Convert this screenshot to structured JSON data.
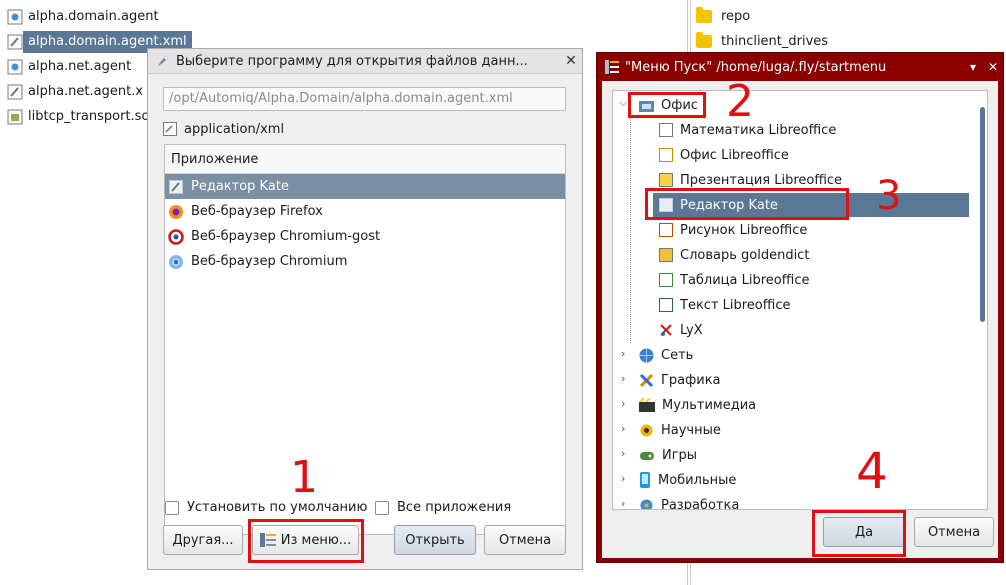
{
  "file_list": [
    {
      "name": "alpha.domain.agent",
      "icon": "gear-file-icon",
      "selected": false
    },
    {
      "name": "alpha.domain.agent.xml",
      "icon": "text-file-icon",
      "selected": true
    },
    {
      "name": "alpha.net.agent",
      "icon": "gear-file-icon",
      "selected": false
    },
    {
      "name": "alpha.net.agent.x",
      "icon": "text-file-icon",
      "selected": false
    },
    {
      "name": "libtcp_transport.so",
      "icon": "library-file-icon",
      "selected": false
    }
  ],
  "right_pane": [
    {
      "name": "repo",
      "icon": "folder-icon"
    },
    {
      "name": "thinclient_drives",
      "icon": "folder-icon"
    }
  ],
  "open_with_dialog": {
    "title": "Выберите программу для открытия файлов данн...",
    "path": "/opt/Automiq/Alpha.Domain/alpha.domain.agent.xml",
    "mime_type": "application/xml",
    "list_header": "Приложение",
    "apps": [
      {
        "label": "Редактор Kate",
        "selected": true
      },
      {
        "label": "Веб-браузер Firefox",
        "selected": false
      },
      {
        "label": "Веб-браузер Chromium-gost",
        "selected": false
      },
      {
        "label": "Веб-браузер Chromium",
        "selected": false
      }
    ],
    "checkbox_default": "Установить по умолчанию",
    "checkbox_all": "Все приложения",
    "btn_other": "Другая...",
    "btn_from_menu": "Из меню...",
    "btn_open": "Открыть",
    "btn_cancel": "Отмена",
    "close": "✕"
  },
  "start_menu_dialog": {
    "title": "\"Меню Пуск\" /home/luga/.fly/startmenu",
    "min": "▾",
    "close": "✕",
    "tree": [
      {
        "label": "Офис",
        "level": 0,
        "expanded": true
      },
      {
        "label": "Математика Libreoffice",
        "level": 1
      },
      {
        "label": "Офис Libreoffice",
        "level": 1
      },
      {
        "label": "Презентация Libreoffice",
        "level": 1
      },
      {
        "label": "Редактор Kate",
        "level": 1,
        "selected": true
      },
      {
        "label": "Рисунок Libreoffice",
        "level": 1
      },
      {
        "label": "Словарь goldendict",
        "level": 1
      },
      {
        "label": "Таблица Libreoffice",
        "level": 1
      },
      {
        "label": "Текст Libreoffice",
        "level": 1
      },
      {
        "label": "LyX",
        "level": 1
      },
      {
        "label": "Сеть",
        "level": 0
      },
      {
        "label": "Графика",
        "level": 0
      },
      {
        "label": "Мультимедиа",
        "level": 0
      },
      {
        "label": "Научные",
        "level": 0
      },
      {
        "label": "Игры",
        "level": 0
      },
      {
        "label": "Мобильные",
        "level": 0
      },
      {
        "label": "Разработка",
        "level": 0
      }
    ],
    "btn_yes": "Да",
    "btn_cancel": "Отмена"
  },
  "annotations": {
    "n1": "1",
    "n2": "2",
    "n3": "3",
    "n4": "4"
  },
  "colors": {
    "selection": "#5a7895",
    "annotation": "#e01010",
    "start_menu_frame": "#8a0000"
  }
}
